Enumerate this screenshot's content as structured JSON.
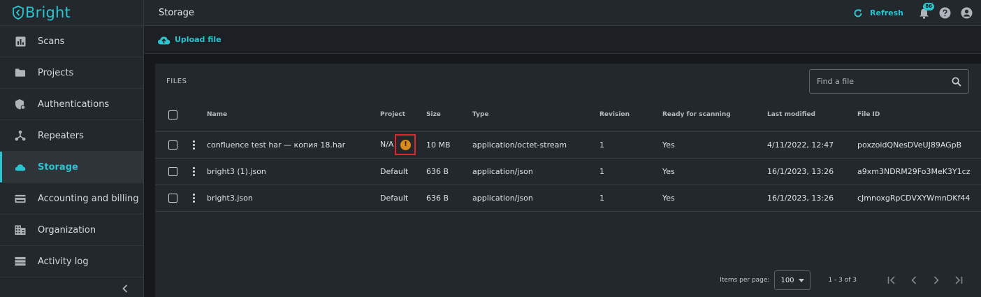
{
  "brand": {
    "name": "Bright",
    "accent": "#2bc3cf"
  },
  "sidebar": {
    "items": [
      {
        "label": "Scans",
        "icon": "bar-chart-icon",
        "active": false
      },
      {
        "label": "Projects",
        "icon": "folder-icon",
        "active": false
      },
      {
        "label": "Authentications",
        "icon": "shield-lock-icon",
        "active": false
      },
      {
        "label": "Repeaters",
        "icon": "repeater-nodes-icon",
        "active": false
      },
      {
        "label": "Storage",
        "icon": "cloud-icon",
        "active": true
      },
      {
        "label": "Accounting and billing",
        "icon": "credit-card-icon",
        "active": false
      },
      {
        "label": "Organization",
        "icon": "building-icon",
        "active": false
      },
      {
        "label": "Activity log",
        "icon": "list-icon",
        "active": false
      }
    ],
    "collapse_icon": "chevron-left-icon"
  },
  "header": {
    "title": "Storage",
    "refresh_label": "Refresh",
    "notifications_count": "86"
  },
  "toolbar": {
    "upload_label": "Upload file"
  },
  "files": {
    "section_label": "FILES",
    "search_placeholder": "Find a file",
    "columns": [
      "Name",
      "Project",
      "Size",
      "Type",
      "Revision",
      "Ready for scanning",
      "Last modified",
      "File ID"
    ],
    "rows": [
      {
        "name": "confluence test har — копия 18.har",
        "project": "N/A",
        "warning": true,
        "warning_glyph": "!",
        "size": "10 MB",
        "type": "application/octet-stream",
        "revision": "1",
        "ready": "Yes",
        "modified": "4/11/2022, 12:47",
        "file_id": "poxzoidQNesDVeUJ89AGpB"
      },
      {
        "name": "bright3 (1).json",
        "project": "Default",
        "warning": false,
        "size": "636 B",
        "type": "application/json",
        "revision": "1",
        "ready": "Yes",
        "modified": "16/1/2023, 13:26",
        "file_id": "a9xm3NDRM29Fo3MeK3Y1cz"
      },
      {
        "name": "bright3.json",
        "project": "Default",
        "warning": false,
        "size": "636 B",
        "type": "application/json",
        "revision": "1",
        "ready": "Yes",
        "modified": "16/1/2023, 13:26",
        "file_id": "cJmnoxgRpCDVXYWmnDKf44"
      }
    ]
  },
  "pagination": {
    "items_per_page_label": "Items per page:",
    "items_per_page_value": "100",
    "range": "1 - 3 of 3"
  }
}
